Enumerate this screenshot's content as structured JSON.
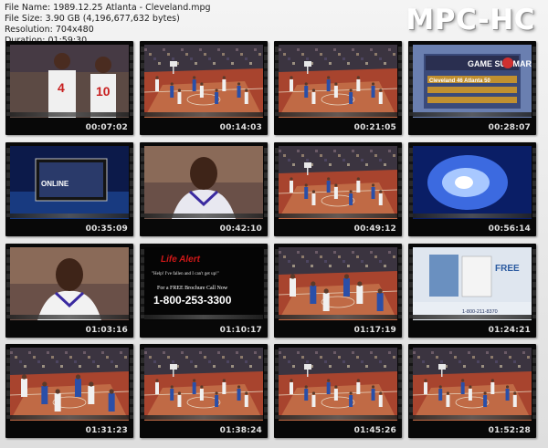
{
  "window": {
    "title": "1989.12.25 Atlanta - Cleveland.mpg"
  },
  "info": {
    "file_name": "File Name: 1989.12.25 Atlanta - Cleveland.mpg",
    "file_size": "File Size: 3.90 GB (4,196,677,632 bytes)",
    "resolution": "Resolution: 704x480",
    "duration": "Duration: 01:59:30"
  },
  "brand": "MPC-HC",
  "thumbnails": [
    {
      "time": "00:07:02",
      "scene": "players-closeup",
      "overlay": "",
      "jersey": [
        "4",
        "10"
      ]
    },
    {
      "time": "00:14:03",
      "scene": "court-wide",
      "overlay": ""
    },
    {
      "time": "00:21:05",
      "scene": "court-wide",
      "overlay": ""
    },
    {
      "time": "00:28:07",
      "scene": "game-summary",
      "overlay": "GAME SUMMARY",
      "summary_lines": [
        "Cleveland 46  Atlanta 50"
      ]
    },
    {
      "time": "00:35:09",
      "scene": "tv-graphic",
      "overlay": "ONLINE"
    },
    {
      "time": "00:42:10",
      "scene": "player-portrait",
      "overlay": ""
    },
    {
      "time": "00:49:12",
      "scene": "court-wide",
      "overlay": ""
    },
    {
      "time": "00:56:14",
      "scene": "blue-flare",
      "overlay": ""
    },
    {
      "time": "01:03:16",
      "scene": "player-portrait",
      "overlay": ""
    },
    {
      "time": "01:10:17",
      "scene": "ad-lifealert",
      "overlay": "Life Alert",
      "ad_line1": "\"Help! I've fallen and I can't get up!\"",
      "ad_line2": "For a FREE Brochure Call Now",
      "ad_phone": "1-800-253-3300"
    },
    {
      "time": "01:17:19",
      "scene": "court-close",
      "overlay": ""
    },
    {
      "time": "01:24:21",
      "scene": "ad-brochure",
      "overlay": "FREE",
      "ad_phone": "1-800-211-8370"
    },
    {
      "time": "01:31:23",
      "scene": "court-close",
      "overlay": ""
    },
    {
      "time": "01:38:24",
      "scene": "court-wide",
      "overlay": ""
    },
    {
      "time": "01:45:26",
      "scene": "court-wide",
      "overlay": ""
    },
    {
      "time": "01:52:28",
      "scene": "court-wide",
      "overlay": ""
    }
  ],
  "colors": {
    "court": "#a8442e",
    "crowd": "#3b3440",
    "blue_jersey": "#2a4fa8",
    "white_jersey": "#f0f0f0",
    "ad_red": "#d01818"
  }
}
